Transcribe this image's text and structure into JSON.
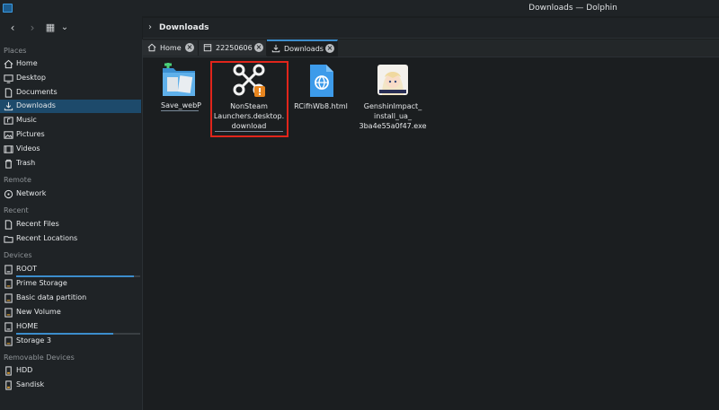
{
  "window": {
    "title": "Downloads — Dolphin"
  },
  "toolbar": {
    "back_glyph": "‹",
    "forward_glyph": "›",
    "view_glyph": "▦",
    "view_menu_glyph": "⌄"
  },
  "sidebar": {
    "sections": {
      "places": "Places",
      "remote": "Remote",
      "recent": "Recent",
      "devices": "Devices",
      "removable": "Removable Devices"
    },
    "places": [
      {
        "label": "Home",
        "icon": "home-icon"
      },
      {
        "label": "Desktop",
        "icon": "desktop-icon"
      },
      {
        "label": "Documents",
        "icon": "documents-icon"
      },
      {
        "label": "Downloads",
        "icon": "download-icon",
        "active": true
      },
      {
        "label": "Music",
        "icon": "music-icon"
      },
      {
        "label": "Pictures",
        "icon": "pictures-icon"
      },
      {
        "label": "Videos",
        "icon": "videos-icon"
      },
      {
        "label": "Trash",
        "icon": "trash-icon"
      }
    ],
    "remote": [
      {
        "label": "Network",
        "icon": "network-icon"
      }
    ],
    "recent": [
      {
        "label": "Recent Files",
        "icon": "recent-files-icon"
      },
      {
        "label": "Recent Locations",
        "icon": "recent-locations-icon"
      }
    ],
    "devices": [
      {
        "label": "ROOT",
        "icon": "drive-icon",
        "usage": 0.95
      },
      {
        "label": "Prime Storage",
        "icon": "drive-icon"
      },
      {
        "label": "Basic data partition",
        "icon": "drive-icon"
      },
      {
        "label": "New Volume",
        "icon": "drive-icon"
      },
      {
        "label": "HOME",
        "icon": "drive-icon",
        "usage": 0.78
      },
      {
        "label": "Storage 3",
        "icon": "drive-icon"
      }
    ],
    "removable": [
      {
        "label": "HDD",
        "icon": "usb-drive-icon"
      },
      {
        "label": "Sandisk",
        "icon": "usb-drive-icon"
      }
    ]
  },
  "breadcrumb": {
    "chevron": "›",
    "current": "Downloads"
  },
  "tabs": [
    {
      "label": "Home",
      "icon": "home-icon"
    },
    {
      "label": "22250606",
      "icon": "calendar-icon"
    },
    {
      "label": "Downloads",
      "icon": "download-icon",
      "active": true
    }
  ],
  "tab_close_glyph": "×",
  "files": [
    {
      "name": "Save_webP",
      "icon": "folder-icon"
    },
    {
      "name_lines": [
        "NonSteam",
        "Launchers.desktop.",
        "download"
      ],
      "icon": "app-download-icon",
      "highlighted": true
    },
    {
      "name": "RCifhWb8.html",
      "icon": "html-file-icon"
    },
    {
      "name_lines": [
        "GenshinImpact_",
        "install_ua_",
        "3ba4e55a0f47.exe"
      ],
      "icon": "exe-thumbnail-icon"
    }
  ],
  "colors": {
    "accent": "#3c8dcc",
    "highlight_border": "#e1251b",
    "background": "#1b1e20"
  }
}
